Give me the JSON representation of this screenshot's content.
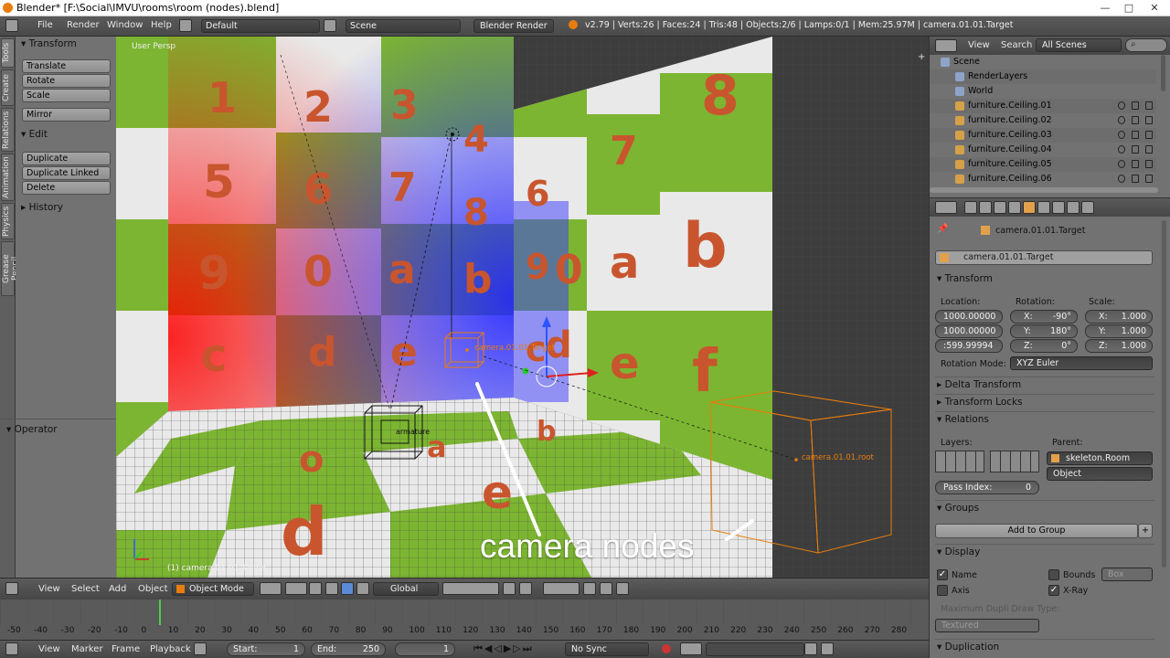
{
  "window": {
    "title": "Blender* [F:\\Social\\IMVU\\rooms\\room (nodes).blend]",
    "min": "—",
    "max": "□",
    "close": "✕"
  },
  "info_header": {
    "menus": [
      "File",
      "Render",
      "Window",
      "Help"
    ],
    "layout": "Default",
    "scene": "Scene",
    "engine": "Blender Render",
    "stats": "v2.79 | Verts:26 | Faces:24 | Tris:48 | Objects:2/6 | Lamps:0/1 | Mem:25.97M | camera.01.01.Target"
  },
  "tool_tabs": [
    "Tools",
    "Create",
    "Relations",
    "Animation",
    "Physics",
    "Grease Pencil"
  ],
  "toolshelf": {
    "transform_header": "Transform",
    "transform_buttons": [
      "Translate",
      "Rotate",
      "Scale"
    ],
    "mirror": "Mirror",
    "edit_header": "Edit",
    "edit_buttons": [
      "Duplicate",
      "Duplicate Linked",
      "Delete"
    ],
    "history_header": "History",
    "operator_header": "Operator"
  },
  "viewport": {
    "view_label": "User Persp",
    "object_label": "(1) camera.01.01.Target",
    "target_label": "camera.01.01.Target",
    "root_label": "camera.01.01.root",
    "armature_label": "armature",
    "annotation": "camera nodes",
    "wall_left": [
      "1",
      "5",
      "9",
      "c",
      "3",
      "4",
      "0",
      "8"
    ],
    "wall_back": [
      "2",
      "3",
      "4",
      "6",
      "7",
      "8",
      "0",
      "a",
      "b",
      "d",
      "e"
    ],
    "wall_right": [
      "6",
      "7",
      "8",
      "9",
      "0",
      "a",
      "b",
      "c",
      "d",
      "e",
      "f"
    ],
    "floor": [
      "d",
      "e",
      "o",
      "a",
      "b",
      "c",
      "d",
      "e",
      "f"
    ]
  },
  "view3d_header": {
    "menus": [
      "View",
      "Select",
      "Add",
      "Object"
    ],
    "mode": "Object Mode",
    "orientation": "Global"
  },
  "timeline": {
    "ticks": [
      "-50",
      "-40",
      "-30",
      "-20",
      "-10",
      "0",
      "10",
      "20",
      "30",
      "40",
      "50",
      "60",
      "70",
      "80",
      "90",
      "100",
      "110",
      "120",
      "130",
      "140",
      "150",
      "160",
      "170",
      "180",
      "190",
      "200",
      "210",
      "220",
      "230",
      "240",
      "250",
      "260",
      "270",
      "280"
    ],
    "menus": [
      "View",
      "Marker",
      "Frame",
      "Playback"
    ],
    "start_label": "Start:",
    "start": "1",
    "end_label": "End:",
    "end": "250",
    "current": "1",
    "sync": "No Sync"
  },
  "outliner": {
    "menus": [
      "View",
      "Search"
    ],
    "filter": "All Scenes",
    "rows": [
      {
        "name": "Scene",
        "indent": 0
      },
      {
        "name": "RenderLayers",
        "indent": 1
      },
      {
        "name": "World",
        "indent": 1
      },
      {
        "name": "furniture.Ceiling.01",
        "indent": 1
      },
      {
        "name": "furniture.Ceiling.02",
        "indent": 1
      },
      {
        "name": "furniture.Ceiling.03",
        "indent": 1
      },
      {
        "name": "furniture.Ceiling.04",
        "indent": 1
      },
      {
        "name": "furniture.Ceiling.05",
        "indent": 1
      },
      {
        "name": "furniture.Ceiling.06",
        "indent": 1
      }
    ]
  },
  "properties": {
    "breadcrumb": "camera.01.01.Target",
    "object_name": "camera.01.01.Target",
    "transform": "Transform",
    "location_label": "Location:",
    "rotation_label": "Rotation:",
    "scale_label": "Scale:",
    "location": [
      "1000.00000",
      "1000.00000",
      ":599.99994"
    ],
    "rotation": [
      {
        "axis": "X:",
        "val": "-90°"
      },
      {
        "axis": "Y:",
        "val": "180°"
      },
      {
        "axis": "Z:",
        "val": "0°"
      }
    ],
    "scale": [
      {
        "axis": "X:",
        "val": "1.000"
      },
      {
        "axis": "Y:",
        "val": "1.000"
      },
      {
        "axis": "Z:",
        "val": "1.000"
      }
    ],
    "rotation_mode_label": "Rotation Mode:",
    "rotation_mode": "XYZ Euler",
    "delta_transform": "Delta Transform",
    "transform_locks": "Transform Locks",
    "relations": "Relations",
    "layers_label": "Layers:",
    "parent_label": "Parent:",
    "parent": "skeleton.Room",
    "parent_type": "Object",
    "pass_index_label": "Pass Index:",
    "pass_index": "0",
    "groups": "Groups",
    "add_to_group": "Add to Group",
    "display": "Display",
    "name_label": "Name",
    "bounds_label": "Bounds",
    "bounds_type": "Box",
    "axis_label": "Axis",
    "xray_label": "X-Ray",
    "max_draw_label": "Maximum Dupli Draw Type:",
    "max_draw": "Textured",
    "duplication": "Duplication"
  },
  "colors": {
    "green": "#7cb531",
    "white_tile": "#e9e9e9",
    "glyph": "#c8552e",
    "selection": "#e87d0d"
  }
}
